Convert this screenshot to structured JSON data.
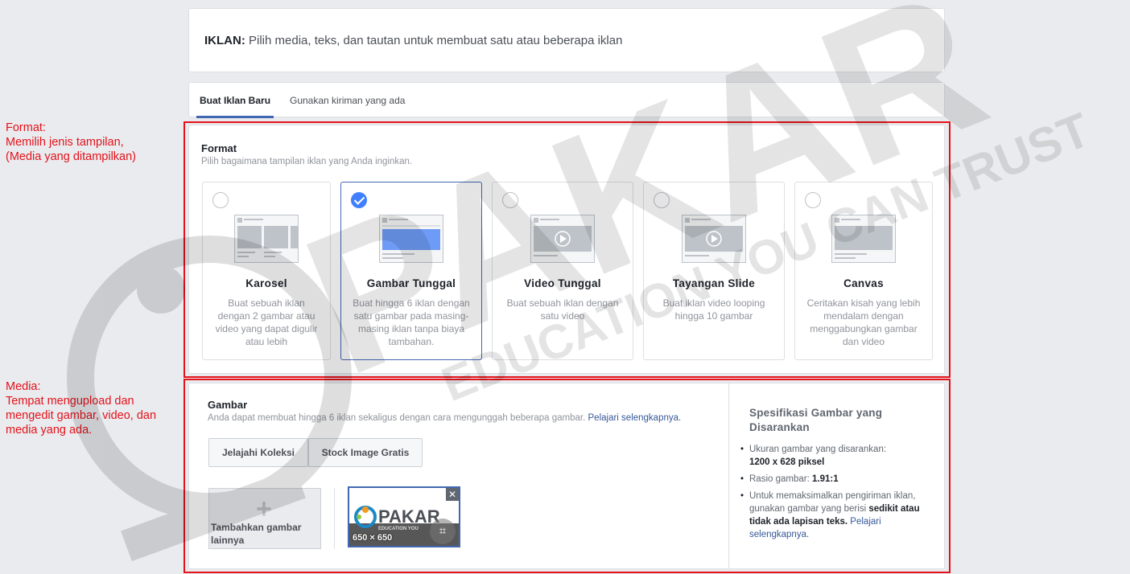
{
  "annotations": {
    "format": [
      "Format:",
      "Memilih jenis tampilan,",
      "(Media yang ditampilkan)"
    ],
    "media": [
      "Media:",
      "Tempat mengupload dan",
      "mengedit gambar, video, dan",
      "media yang ada."
    ]
  },
  "header": {
    "label": "IKLAN:",
    "text": " Pilih media, teks, dan tautan untuk membuat satu atau beberapa iklan"
  },
  "tabs": [
    {
      "label": "Buat Iklan Baru",
      "active": true
    },
    {
      "label": "Gunakan kiriman yang ada",
      "active": false
    }
  ],
  "format_section": {
    "title": "Format",
    "subtitle": "Pilih bagaimana tampilan iklan yang Anda inginkan.",
    "options": [
      {
        "title": "Karosel",
        "desc": "Buat sebuah iklan dengan 2 gambar atau video yang dapat digulir atau lebih",
        "selected": false
      },
      {
        "title": "Gambar Tunggal",
        "desc": "Buat hingga 6 iklan dengan satu gambar pada masing-masing iklan tanpa biaya tambahan.",
        "selected": true
      },
      {
        "title": "Video Tunggal",
        "desc": "Buat sebuah iklan dengan satu video",
        "selected": false
      },
      {
        "title": "Tayangan Slide",
        "desc": "Buat iklan video looping hingga 10 gambar",
        "selected": false
      },
      {
        "title": "Canvas",
        "desc": "Ceritakan kisah yang lebih mendalam dengan menggabungkan gambar dan video",
        "selected": false
      }
    ]
  },
  "media_section": {
    "title": "Gambar",
    "subtitle": "Anda dapat membuat hingga 6 iklan sekaligus dengan cara mengunggah beberapa gambar.",
    "subtitle_link": "Pelajari selengkapnya.",
    "buttons": {
      "browse": "Jelajahi Koleksi",
      "stock": "Stock Image Gratis"
    },
    "add_image_label": "Tambahkan gambar lainnya",
    "thumb": {
      "dimensions": "650 × 650",
      "logo_text": "PAKAR",
      "logo_sub": "EDUCATION YOU"
    }
  },
  "specs": {
    "title": "Spesifikasi Gambar yang Disarankan",
    "size_label": "Ukuran gambar yang disarankan:",
    "size_value": "1200 x 628 piksel",
    "ratio_label": "Rasio gambar: ",
    "ratio_value": "1.91:1",
    "delivery_text": "Untuk memaksimalkan pengiriman iklan, gunakan gambar yang berisi ",
    "delivery_bold": "sedikit atau tidak ada lapisan teks.",
    "delivery_link": "Pelajari selengkapnya."
  },
  "watermark": {
    "brand": "PAKAR",
    "tagline": "EDUCATION YOU CAN TRUST"
  },
  "colors": {
    "accent": "#4267b2",
    "annotation": "#e4121b",
    "check": "#4080ff"
  }
}
